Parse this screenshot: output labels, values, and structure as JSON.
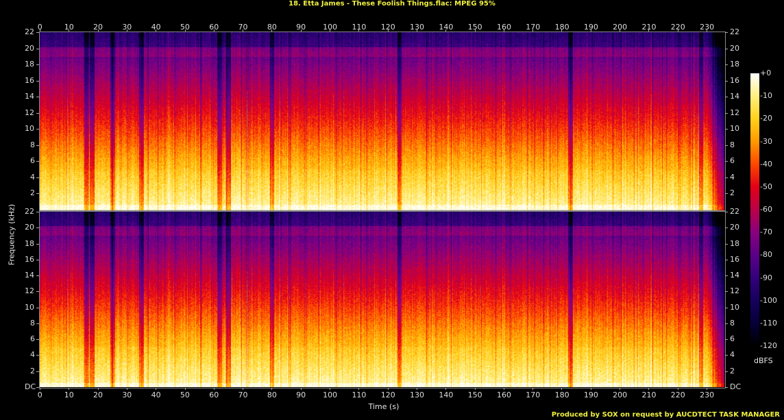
{
  "title": "18. Etta James - These Foolish Things.flac: MPEG 95%",
  "footer": "Produced by SOX on request by AUCDTECT TASK MANAGER",
  "chart_data": {
    "type": "heatmap",
    "title": "18. Etta James - These Foolish Things.flac: MPEG 95%",
    "xlabel": "Time (s)",
    "ylabel": "Frequency (kHz)",
    "xlim": [
      0,
      236
    ],
    "ylim": [
      0,
      22
    ],
    "x_ticks": [
      "0",
      "10",
      "20",
      "30",
      "40",
      "50",
      "60",
      "70",
      "80",
      "90",
      "100",
      "110",
      "120",
      "130",
      "140",
      "150",
      "160",
      "170",
      "180",
      "190",
      "200",
      "210",
      "220",
      "230"
    ],
    "y_ticks": [
      "DC",
      "2",
      "4",
      "6",
      "8",
      "10",
      "12",
      "14",
      "16",
      "18",
      "20",
      "22"
    ],
    "channels": [
      "top",
      "bottom"
    ],
    "colorbar": {
      "label": "dBFS",
      "ticks": [
        "+0",
        "-10",
        "-20",
        "-30",
        "-40",
        "-50",
        "-60",
        "-70",
        "-80",
        "-90",
        "-100",
        "-110",
        "-120"
      ],
      "range": [
        -120,
        0
      ]
    },
    "colormap": [
      "#000000",
      "#06003a",
      "#16005e",
      "#34007c",
      "#5c0088",
      "#8a0080",
      "#bc0048",
      "#e40018",
      "#ff4800",
      "#ff9a00",
      "#ffd21a",
      "#fff080",
      "#ffffff"
    ],
    "quiet_times_s": [
      16,
      18,
      25,
      35,
      62,
      65,
      80,
      124,
      183,
      228
    ],
    "fade_out_s": [
      230,
      236
    ]
  }
}
